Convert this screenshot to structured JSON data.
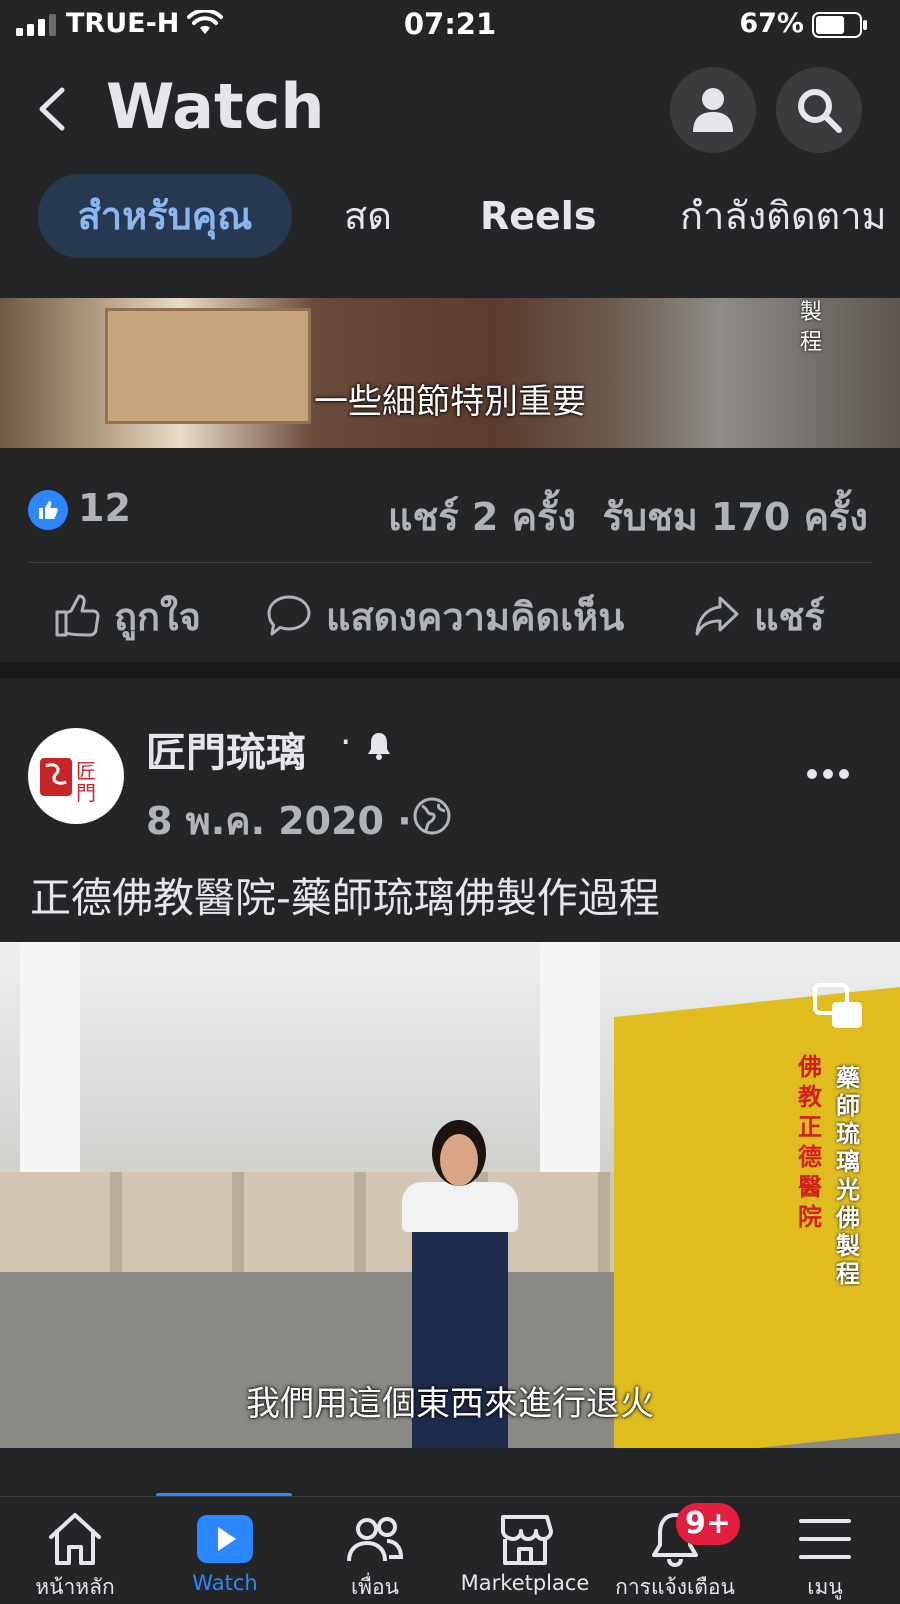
{
  "status_bar": {
    "carrier": "TRUE-H",
    "time": "07:21",
    "battery_percent": "67%",
    "battery_level": 0.67,
    "signal_bars": 3
  },
  "header": {
    "title": "Watch",
    "back_icon": "chevron-left-icon",
    "profile_icon": "person-icon",
    "search_icon": "search-icon"
  },
  "tabs": [
    {
      "label": "สำหรับคุณ",
      "active": true
    },
    {
      "label": "สด",
      "active": false
    },
    {
      "label": "Reels",
      "active": false
    },
    {
      "label": "กำลังติดตาม",
      "active": false
    }
  ],
  "post1": {
    "video_subtitle": "一些細節特別重要",
    "video_side_text": "製程",
    "like_count": "12",
    "shares": "แชร์ 2 ครั้ง",
    "views": "รับชม 170 ครั้ง",
    "actions": {
      "like": "ถูกใจ",
      "comment": "แสดงความคิดเห็น",
      "share": "แชร์"
    }
  },
  "post2": {
    "page_name": "匠門琉璃",
    "avatar_text": "匠門",
    "date": "8 พ.ค. 2020",
    "separator": "·",
    "title": "正德佛教醫院-藥師琉璃佛製作過程",
    "video_subtitle": "我們用這個東西來進行退火",
    "video_side_text_1": "藥師琉璃光佛製程",
    "video_side_text_2": "佛教正德醫院"
  },
  "bottom_nav": {
    "items": [
      {
        "label": "หน้าหลัก",
        "icon": "home-icon"
      },
      {
        "label": "Watch",
        "icon": "watch-play-icon",
        "active": true
      },
      {
        "label": "เพื่อน",
        "icon": "friends-icon"
      },
      {
        "label": "Marketplace",
        "icon": "marketplace-icon"
      },
      {
        "label": "การแจ้งเตือน",
        "icon": "bell-icon",
        "badge": "9+"
      },
      {
        "label": "เมนู",
        "icon": "menu-icon"
      }
    ]
  },
  "colors": {
    "background": "#242526",
    "accent": "#2d88ff",
    "active_tab_bg": "#263951",
    "badge": "#e41e3f"
  }
}
